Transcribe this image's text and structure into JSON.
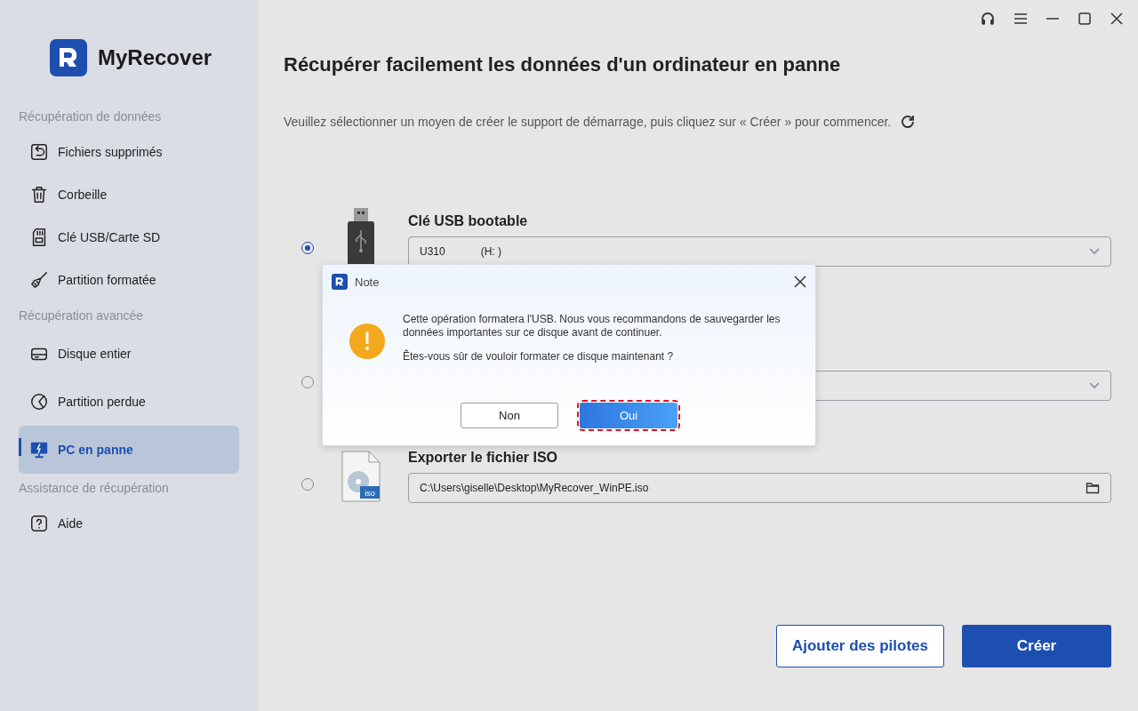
{
  "app": {
    "name": "MyRecover"
  },
  "sidebar": {
    "sections": [
      {
        "heading": "Récupération de données",
        "items": [
          {
            "label": "Fichiers supprimés",
            "kind": "restore",
            "selected": false
          },
          {
            "label": "Corbeille",
            "kind": "trash",
            "selected": false
          },
          {
            "label": "Clé USB/Carte SD",
            "kind": "sd",
            "selected": false
          },
          {
            "label": "Partition formatée",
            "kind": "broom",
            "selected": false
          }
        ]
      },
      {
        "heading": "Récupération avancée",
        "items": [
          {
            "label": "Disque entier",
            "kind": "disk",
            "selected": false
          },
          {
            "label": "Partition perdue",
            "kind": "pie",
            "selected": false
          },
          {
            "label": "PC en panne",
            "kind": "pc",
            "selected": true
          }
        ]
      },
      {
        "heading": "Assistance de récupération",
        "items": [
          {
            "label": "Aide",
            "kind": "help",
            "selected": false
          }
        ]
      }
    ]
  },
  "main": {
    "title": "Récupérer facilement les données d'un ordinateur en panne",
    "instruction": "Veuillez sélectionner un moyen de créer le support de démarrage, puis cliquez sur « Créer » pour commencer.",
    "options": [
      {
        "kind": "usb",
        "title": "Clé USB bootable",
        "value": "U310",
        "value_2": "(H: )",
        "selected": true
      },
      {
        "kind": "hidden",
        "selected": false
      },
      {
        "kind": "iso",
        "title": "Exporter le fichier ISO",
        "value": "C:\\Users\\giselle\\Desktop\\MyRecover_WinPE.iso",
        "selected": false
      }
    ],
    "buttons": [
      {
        "label": "Ajouter des pilotes",
        "kind": "secondary"
      },
      {
        "label": "Créer",
        "kind": "primary"
      }
    ]
  },
  "dialog": {
    "title": "Note",
    "message": "Cette opération formatera l'USB. Nous vous recommandons de sauvegarder les données importantes sur ce disque avant de continuer.",
    "question": "Êtes-vous sûr de vouloir formater ce disque maintenant ?",
    "buttons": [
      {
        "label": "Non",
        "kind": "secondary",
        "highlighted": false
      },
      {
        "label": "Oui",
        "kind": "primary",
        "highlighted": true
      }
    ]
  }
}
